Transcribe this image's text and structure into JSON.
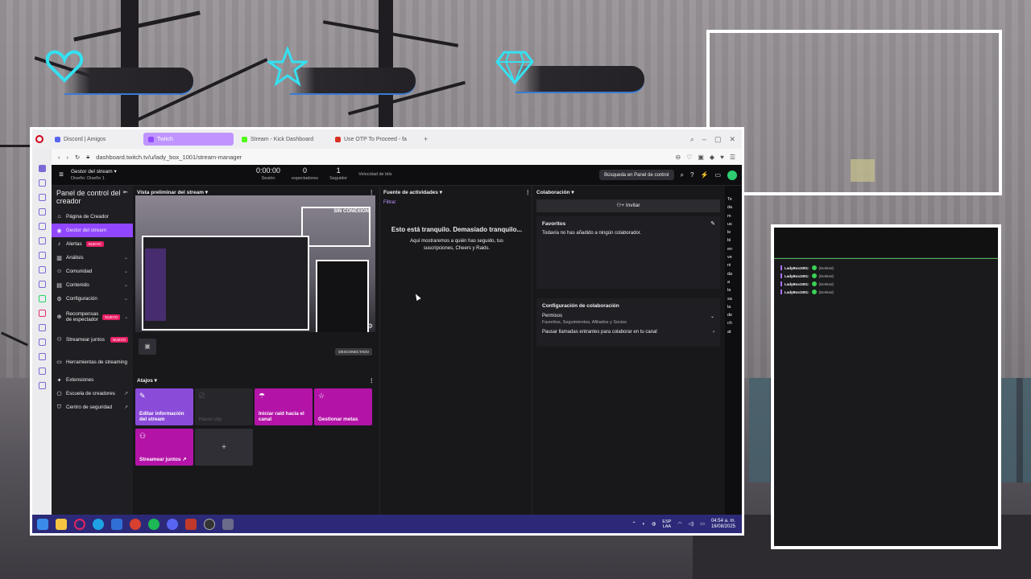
{
  "browser": {
    "tabs": [
      {
        "label": "Discord | Amigos",
        "color": "#5865f2",
        "active": false
      },
      {
        "label": "Twitch",
        "color": "#9147ff",
        "active": true
      },
      {
        "label": "Stream - Kick Dashboard",
        "color": "#53fc18",
        "active": false
      },
      {
        "label": "Use OTP To Proceed - fa",
        "color": "#d93025",
        "active": false
      }
    ],
    "url": "dashboard.twitch.tv/u/lady_box_1001/stream-manager"
  },
  "topnav": {
    "manager_title": "Gestor del stream",
    "manager_sub": "Diseño: Diseño 1",
    "stats": [
      {
        "value": "0:00:00",
        "label": "Sesión"
      },
      {
        "value": "0",
        "label": "espectadores"
      },
      {
        "value": "1",
        "label": "Seguidor"
      },
      {
        "value": "",
        "label": "Velocidad de bits"
      }
    ],
    "search_label": "Búsqueda en Panel de control"
  },
  "sidebar": {
    "title": "Panel de control del creador",
    "items": [
      {
        "label": "Página de Creador",
        "icon": "home-icon",
        "active": false,
        "badge": "",
        "chevron": false
      },
      {
        "label": "Gestor del stream",
        "icon": "broadcast-icon",
        "active": true,
        "badge": "",
        "chevron": false
      },
      {
        "label": "Alertas",
        "icon": "bell-icon",
        "active": false,
        "badge": "NUEVO",
        "chevron": false
      },
      {
        "label": "Análisis",
        "icon": "chart-icon",
        "active": false,
        "badge": "",
        "chevron": true
      },
      {
        "label": "Comunidad",
        "icon": "community-icon",
        "active": false,
        "badge": "",
        "chevron": true
      },
      {
        "label": "Contenido",
        "icon": "content-icon",
        "active": false,
        "badge": "",
        "chevron": true
      },
      {
        "label": "Configuración",
        "icon": "gear-icon",
        "active": false,
        "badge": "",
        "chevron": true
      },
      {
        "label": "Recompensas de espectador",
        "icon": "reward-icon",
        "active": false,
        "badge": "NUEVO",
        "chevron": true
      },
      {
        "label": "Streamear juntos",
        "icon": "together-icon",
        "active": false,
        "badge": "NUEVO",
        "chevron": false
      },
      {
        "label": "Herramientas de streaming",
        "icon": "tools-icon",
        "active": false,
        "badge": "",
        "chevron": false
      },
      {
        "label": "Extensiones",
        "icon": "extension-icon",
        "active": false,
        "badge": "",
        "chevron": false
      },
      {
        "label": "Escuela de creadores",
        "icon": "school-icon",
        "active": false,
        "badge": "",
        "chevron": false
      },
      {
        "label": "Centro de seguridad",
        "icon": "shield-icon",
        "active": false,
        "badge": "",
        "chevron": false
      }
    ]
  },
  "preview": {
    "title": "Vista preliminar del stream",
    "offline": "SIN CONEXIÓN",
    "disconnected": "DESCONECTADO"
  },
  "shortcuts": {
    "title": "Atajos",
    "tiles": [
      {
        "label": "Editar información del stream",
        "icon": "pencil-icon",
        "style": "violet"
      },
      {
        "label": "Hacer clip",
        "icon": "clip-icon",
        "style": "disabled"
      },
      {
        "label": "Iniciar raid hacia el canal",
        "icon": "raid-icon",
        "style": "magenta"
      },
      {
        "label": "Gestionar metas",
        "icon": "star-icon",
        "style": "magenta"
      },
      {
        "label": "Streamear juntos ↗",
        "icon": "add-user-icon",
        "style": "magenta"
      },
      {
        "label": "+",
        "icon": "",
        "style": "add"
      }
    ]
  },
  "activity": {
    "title": "Fuente de actividades",
    "filter": "Filtrar",
    "quiet_title": "Esto está tranquilo. Demasiado tranquilo...",
    "quiet_body": "Aquí mostraremos a quién has seguido, tus suscripciones, Cheers y Raids."
  },
  "collab": {
    "title": "Colaboración",
    "invite": "Invitar",
    "favorites_title": "Favoritos",
    "favorites_empty": "Todavía no has añadido a ningún colaborador.",
    "config_title": "Configuración de colaboración",
    "permissions_label": "Permisos",
    "permissions_sub": "Favoritos, Seguimientos, Afiliados y Socios",
    "pause_label": "Pausar llamadas entrantes para colaborar en tu canal"
  },
  "side_text": [
    "Te",
    "da",
    "m",
    "us",
    "le",
    "bi",
    "en",
    "ve",
    "ni",
    "da",
    "a",
    "la",
    "sa",
    "la",
    "de",
    "ch",
    "at"
  ],
  "taskbar": {
    "lang_1": "ESP",
    "lang_2": "LAA",
    "time": "04:54 a. m.",
    "date": "16/08/2025"
  },
  "overlay_chat": {
    "messages": [
      {
        "name": "LadyBox1001:",
        "text": "(Deleted)"
      },
      {
        "name": "LadyBox1001:",
        "text": "(Deleted)"
      },
      {
        "name": "LadyBox1001:",
        "text": "(Deleted)"
      },
      {
        "name": "LadyBox1001:",
        "text": "(Deleted)"
      }
    ]
  },
  "colors": {
    "twitch_purple": "#9147ff",
    "accent_magenta": "#b314a7",
    "hud_cyan": "#35e0f0"
  }
}
